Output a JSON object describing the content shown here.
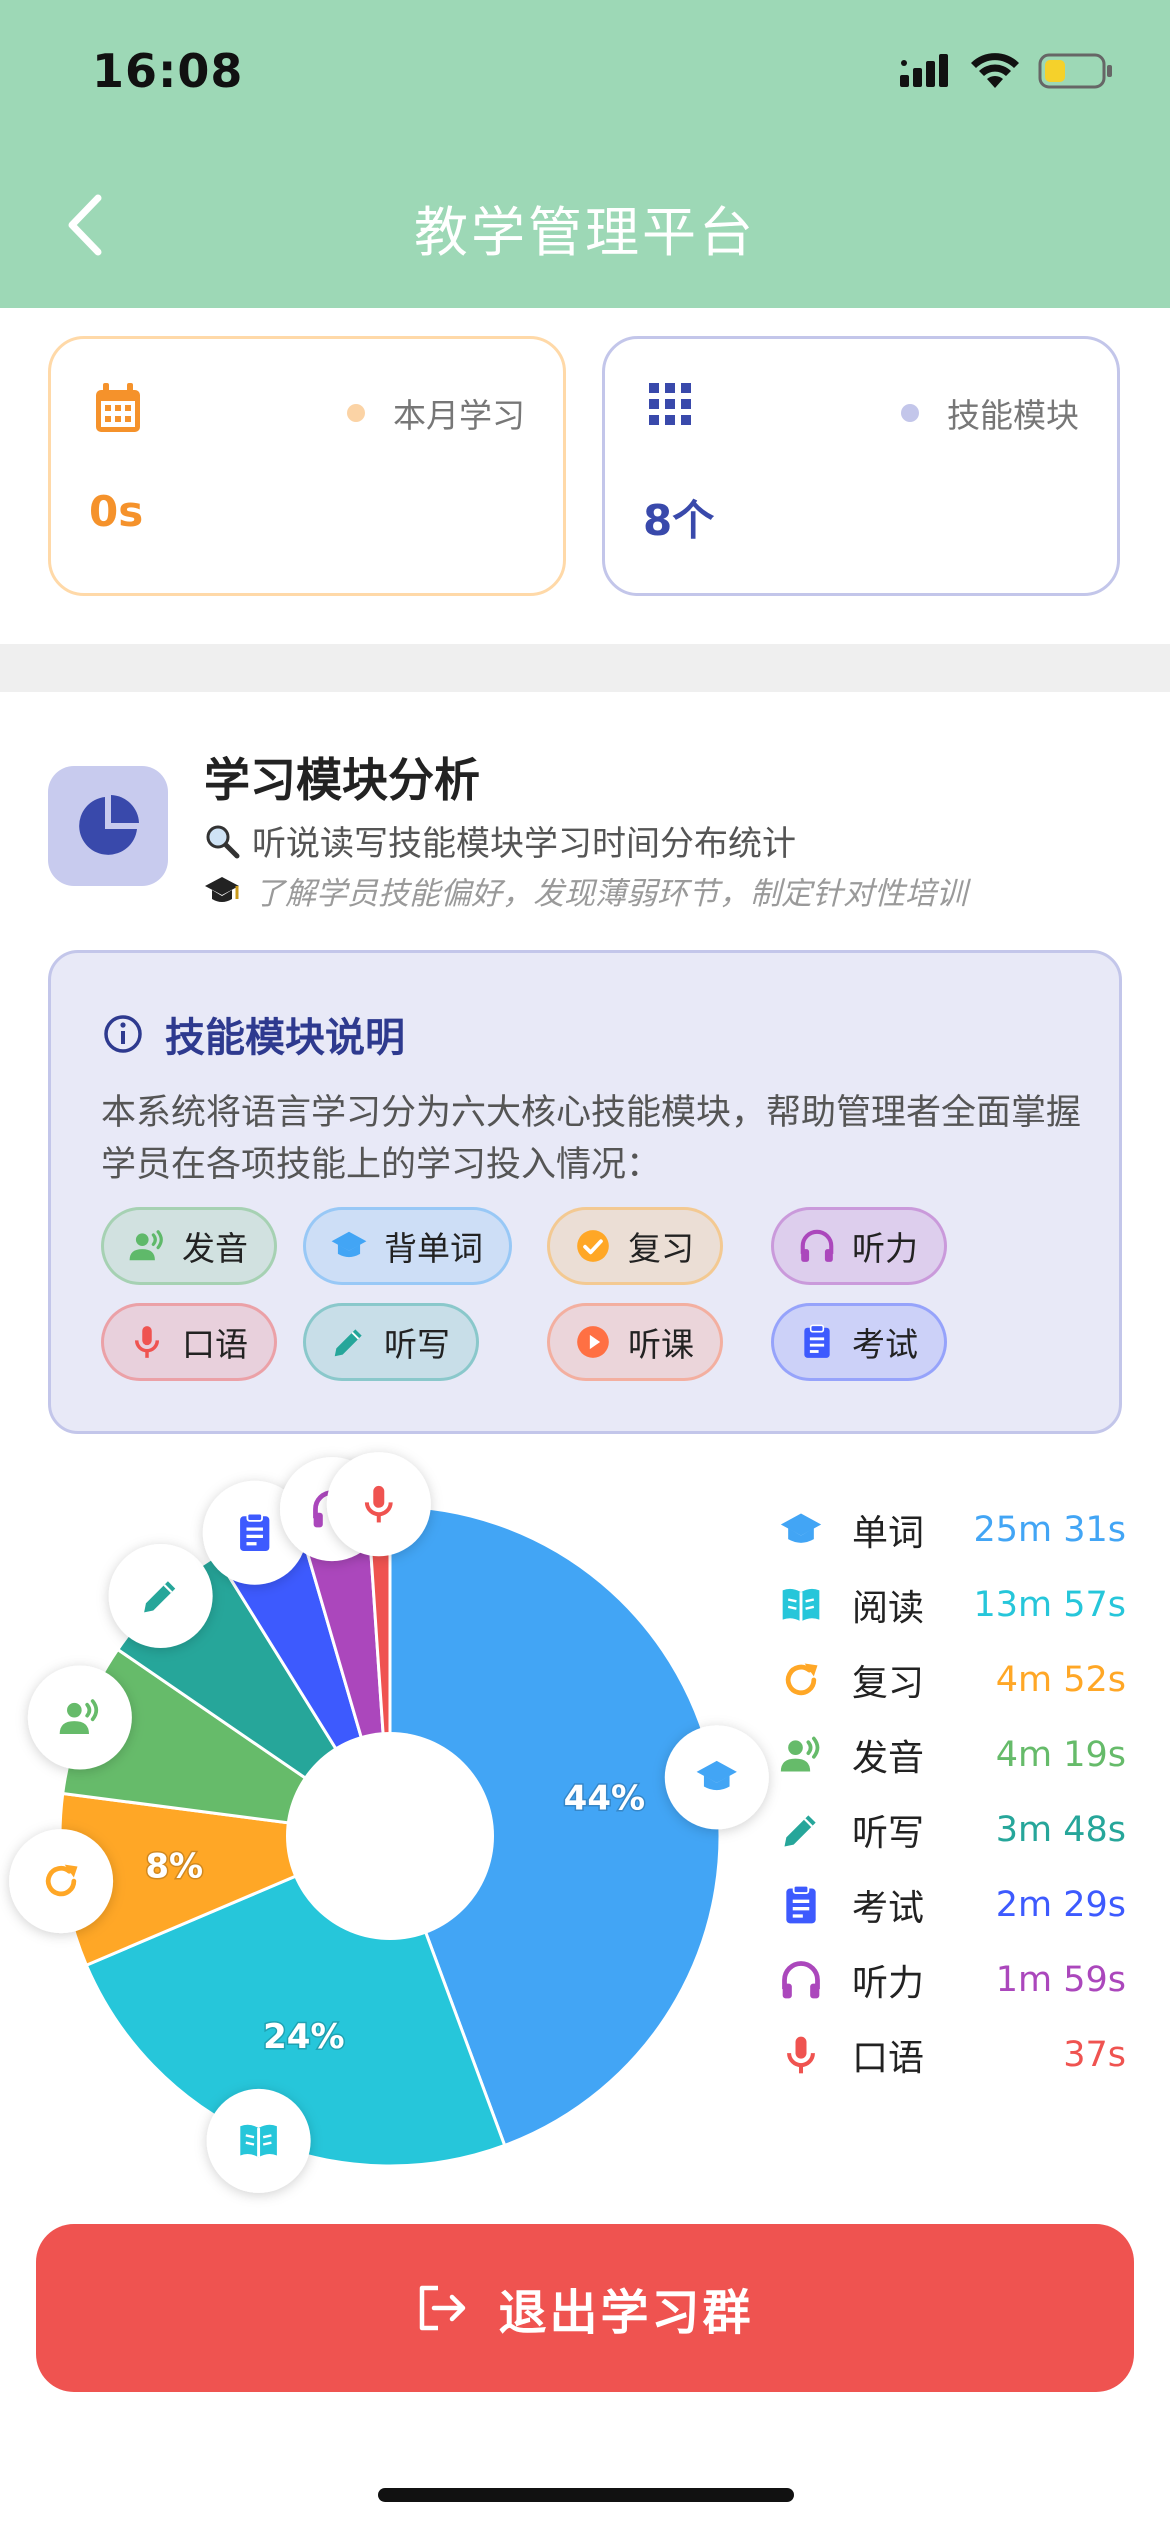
{
  "status_bar": {
    "time": "16:08"
  },
  "nav": {
    "title": "教学管理平台"
  },
  "stats": [
    {
      "label": "本月学习",
      "value": "0s",
      "color": "#f5922b"
    },
    {
      "label": "技能模块",
      "value": "8个",
      "color": "#3949ab"
    }
  ],
  "section": {
    "title": "学习模块分析",
    "subtitle": "听说读写技能模块学习时间分布统计",
    "note": "了解学员技能偏好，发现薄弱环节，制定针对性培训"
  },
  "info": {
    "title": "技能模块说明",
    "text": "本系统将语言学习分为六大核心技能模块，帮助管理者全面掌握学员在各项技能上的学习投入情况：",
    "chips": [
      {
        "label": "发音",
        "icon": "voice-icon",
        "color": "#5fb96a"
      },
      {
        "label": "背单词",
        "icon": "graduation-cap-icon",
        "color": "#42a5f5"
      },
      {
        "label": "复习",
        "icon": "check-circle-icon",
        "color": "#ffa726"
      },
      {
        "label": "听力",
        "icon": "headphones-icon",
        "color": "#ab47bc"
      },
      {
        "label": "口语",
        "icon": "microphone-icon",
        "color": "#ef5350"
      },
      {
        "label": "听写",
        "icon": "pencil-icon",
        "color": "#26a69a"
      },
      {
        "label": "听课",
        "icon": "play-circle-icon",
        "color": "#ff7043"
      },
      {
        "label": "考试",
        "icon": "clipboard-icon",
        "color": "#3d5afe"
      }
    ]
  },
  "chart_data": {
    "type": "pie",
    "series": [
      {
        "name": "单词",
        "value": "25m 31s",
        "seconds": 1531,
        "percent_label": "44%",
        "color": "#42a5f5",
        "icon": "graduation-cap-icon"
      },
      {
        "name": "阅读",
        "value": "13m 57s",
        "seconds": 837,
        "percent_label": "24%",
        "color": "#26c6da",
        "icon": "book-icon"
      },
      {
        "name": "复习",
        "value": "4m 52s",
        "seconds": 292,
        "percent_label": "8%",
        "color": "#ffa726",
        "icon": "refresh-icon"
      },
      {
        "name": "发音",
        "value": "4m 19s",
        "seconds": 259,
        "percent_label": "",
        "color": "#66bb6a",
        "icon": "voice-icon"
      },
      {
        "name": "听写",
        "value": "3m 48s",
        "seconds": 228,
        "percent_label": "",
        "color": "#26a69a",
        "icon": "pencil-icon"
      },
      {
        "name": "考试",
        "value": "2m 29s",
        "seconds": 149,
        "percent_label": "",
        "color": "#3d5afe",
        "icon": "clipboard-icon"
      },
      {
        "name": "听力",
        "value": "1m 59s",
        "seconds": 119,
        "percent_label": "",
        "color": "#ab47bc",
        "icon": "headphones-icon"
      },
      {
        "name": "口语",
        "value": "37s",
        "seconds": 37,
        "percent_label": "",
        "color": "#ef5350",
        "icon": "microphone-icon"
      }
    ]
  },
  "exit_button": {
    "label": "退出学习群"
  }
}
